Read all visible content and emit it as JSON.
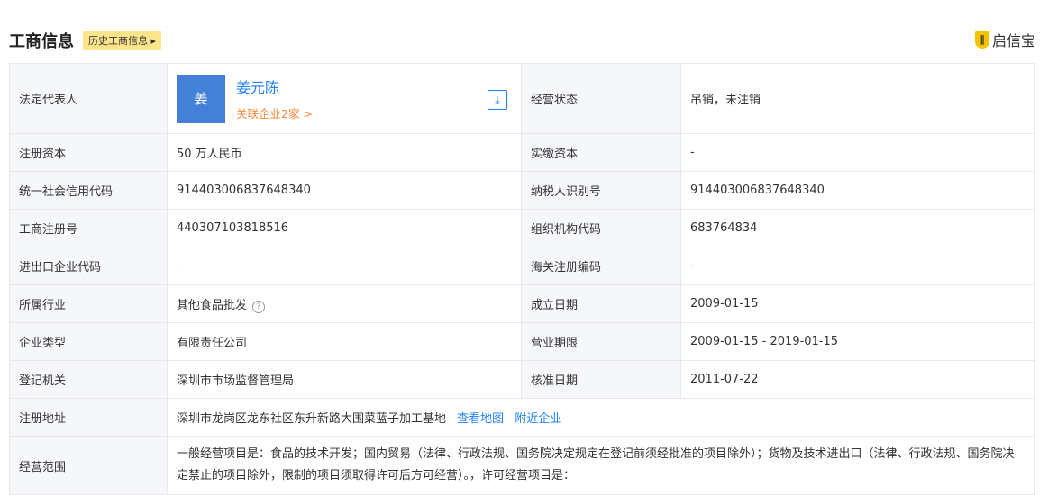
{
  "header": {
    "title": "工商信息",
    "history_label": "历史工商信息",
    "brand": "启信宝"
  },
  "rep": {
    "label": "法定代表人",
    "avatar_char": "姜",
    "name": "姜元陈",
    "related": "关联企业2家 >"
  },
  "rows": [
    {
      "l1": "注册资本",
      "v1": "50 万人民币",
      "l2": "实缴资本",
      "v2": "-"
    },
    {
      "l1": "统一社会信用代码",
      "v1": "914403006837648340",
      "l2": "纳税人识别号",
      "v2": "914403006837648340"
    },
    {
      "l1": "工商注册号",
      "v1": "440307103818516",
      "l2": "组织机构代码",
      "v2": "683764834"
    },
    {
      "l1": "进出口企业代码",
      "v1": "-",
      "l2": "海关注册编码",
      "v2": "-"
    },
    {
      "l1": "所属行业",
      "v1": "其他食品批发",
      "l2": "成立日期",
      "v2": "2009-01-15"
    },
    {
      "l1": "企业类型",
      "v1": "有限责任公司",
      "l2": "营业期限",
      "v2": "2009-01-15 - 2019-01-15"
    },
    {
      "l1": "登记机关",
      "v1": "深圳市市场监督管理局",
      "l2": "核准日期",
      "v2": "2011-07-22"
    }
  ],
  "status": {
    "label": "经营状态",
    "value": "吊销，未注销"
  },
  "address": {
    "label": "注册地址",
    "value": "深圳市龙岗区龙东社区东升新路大围菜蓝子加工基地",
    "map_link": "查看地图",
    "nearby_link": "附近企业"
  },
  "scope": {
    "label": "经营范围",
    "value": "一般经营项目是：食品的技术开发；国内贸易（法律、行政法规、国务院决定规定在登记前须经批准的项目除外）；货物及技术进出口（法律、行政法规、国务院决定禁止的项目除外，限制的项目须取得许可后方可经营）。，许可经营项目是："
  }
}
